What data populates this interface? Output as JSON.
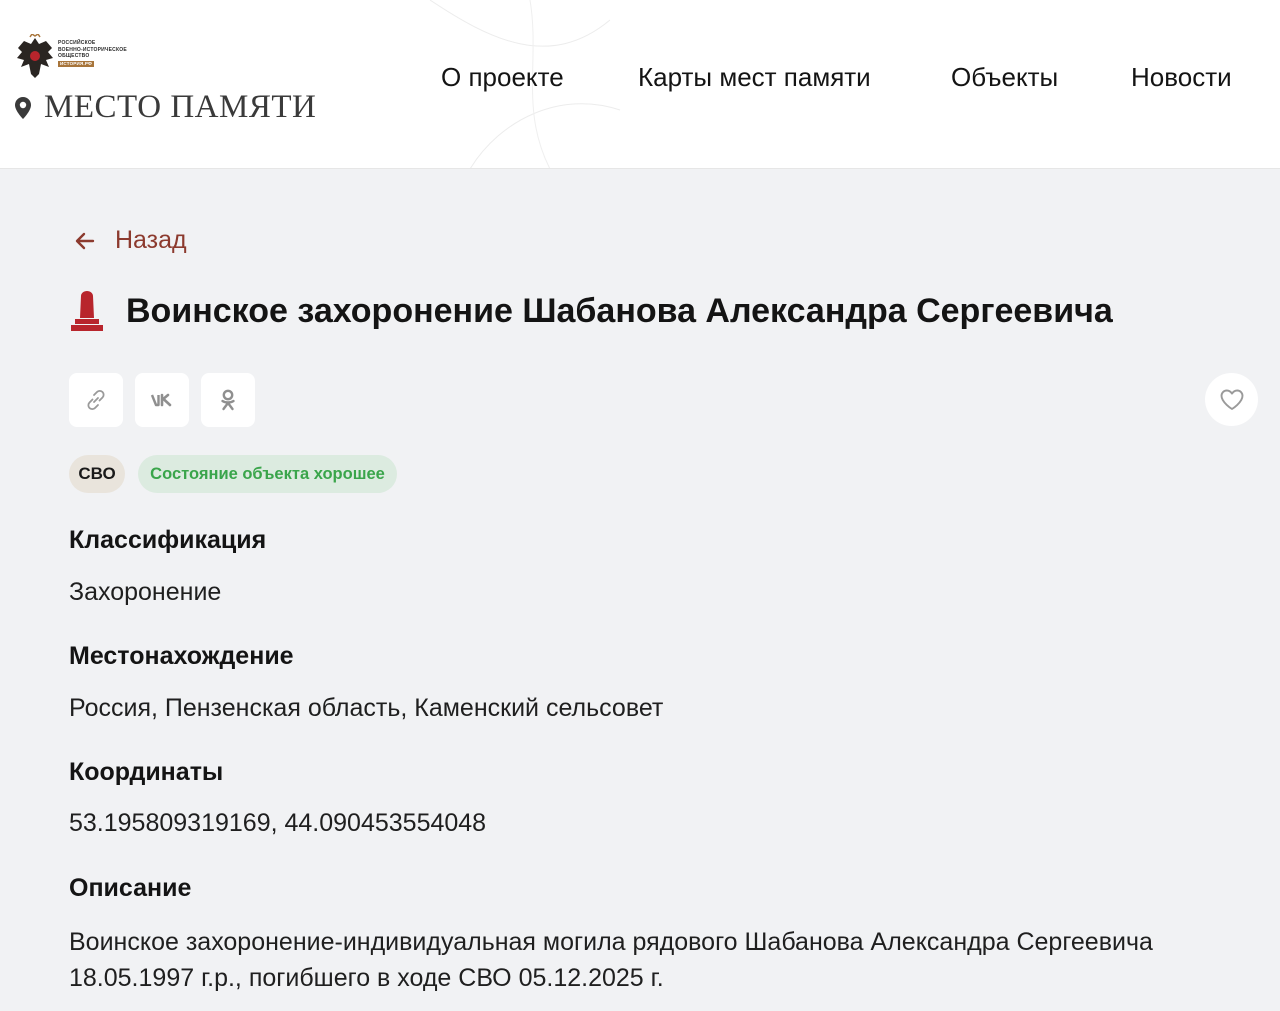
{
  "header": {
    "org_lines": [
      "РОССИЙСКОЕ",
      "ВОЕННО-ИСТОРИЧЕСКОЕ",
      "ОБЩЕСТВО"
    ],
    "org_tag": "ИСТОРИЯ.РФ",
    "site_title": "МЕСТО ПАМЯТИ",
    "nav": [
      "О проекте",
      "Карты мест памяти",
      "Объекты",
      "Новости"
    ]
  },
  "back_label": "Назад",
  "object": {
    "title": "Воинское захоронение Шабанова Александра Сергеевича",
    "badges": {
      "category": "СВО",
      "state": "Состояние объекта хорошее"
    },
    "sections": [
      {
        "label": "Классификация",
        "value": "Захоронение"
      },
      {
        "label": "Местонахождение",
        "value": "Россия, Пензенская область, Каменский сельсовет"
      },
      {
        "label": "Координаты",
        "value": "53.195809319169, 44.090453554048"
      },
      {
        "label": "Описание",
        "value": "Воинское захоронение-индивидуальная могила рядового Шабанова Александра Сергеевича 18.05.1997 г.р., погибшего в ходе СВО 05.12.2025 г."
      }
    ]
  },
  "share": {
    "icons": [
      "link-icon",
      "vk-icon",
      "odnoklassniki-icon"
    ],
    "favorite_icon": "heart-icon"
  },
  "colors": {
    "accent": "#8c3a2e",
    "monument": "#b8252c",
    "state_text": "#3aa54b",
    "state_bg": "#dcebe0",
    "svo_bg": "#e9e4dc",
    "page_bg": "#f1f2f4"
  }
}
